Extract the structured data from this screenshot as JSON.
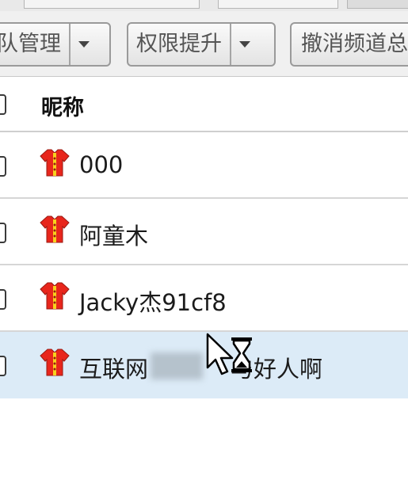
{
  "toolbar": {
    "team_manage_label": "队管理",
    "permission_label": "权限提升",
    "cancel_channel_label": "撤消频道总"
  },
  "table": {
    "column_header": "昵称",
    "rows": [
      {
        "name": "000",
        "icon": "user-shirt-icon"
      },
      {
        "name": "阿童木",
        "icon": "user-shirt-icon"
      },
      {
        "name": "Jacky杰91cf8",
        "icon": "user-shirt-icon"
      },
      {
        "name": "互联网",
        "name_suffix": "与好人啊",
        "icon": "user-shirt-icon",
        "selected": true
      }
    ]
  },
  "cursor": {
    "icon": "busy-cursor-icon"
  },
  "colors": {
    "selected_row": "#dcebf7",
    "icon_red": "#e8261c",
    "icon_yellow": "#f7d21e"
  }
}
